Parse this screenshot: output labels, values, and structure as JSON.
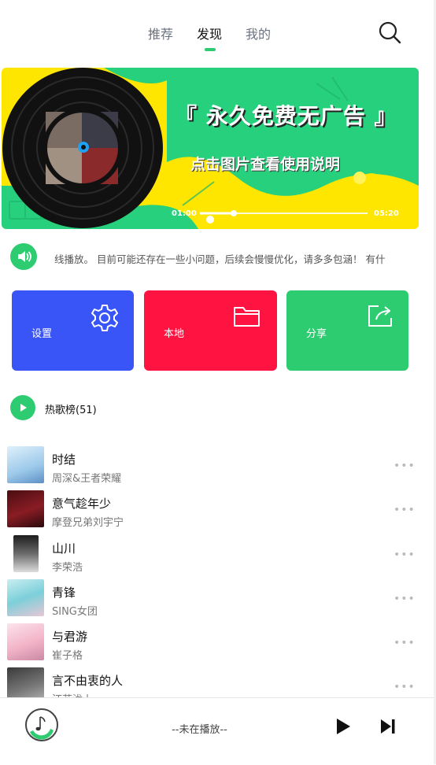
{
  "nav": {
    "tabs": [
      {
        "label": "推荐",
        "active": false
      },
      {
        "label": "发现",
        "active": true
      },
      {
        "label": "我的",
        "active": false
      }
    ],
    "search_icon": "search-icon",
    "accent": "#2ecc71"
  },
  "banner": {
    "title": "『 永久免费无广告 』",
    "subtitle": "点击图片查看使用说明",
    "time_current": "01:00",
    "time_total": "05:20",
    "progress": 0.2,
    "colors": {
      "yellow": "#ffe600",
      "green": "#26d07c"
    }
  },
  "notice": {
    "icon": "speaker-icon",
    "text": "线播放。 目前可能还存在一些小问题，后续会慢慢优化，请多多包涵！ 有什"
  },
  "cards": [
    {
      "label": "设置",
      "icon": "gear-icon",
      "color": "#3a55f7"
    },
    {
      "label": "本地",
      "icon": "folder-icon",
      "color": "#ff1441"
    },
    {
      "label": "分享",
      "icon": "share-icon",
      "color": "#2ecc71"
    }
  ],
  "hot": {
    "label": "热歌榜(51)",
    "icon": "play-icon"
  },
  "songs": [
    {
      "name": "时结",
      "artist": "周深&王者荣耀"
    },
    {
      "name": "意气趁年少",
      "artist": "摩登兄弟刘宇宁"
    },
    {
      "name": "山川",
      "artist": "李荣浩"
    },
    {
      "name": "青锋",
      "artist": "SING女团"
    },
    {
      "name": "与君游",
      "artist": "崔子格"
    },
    {
      "name": "言不由衷的人",
      "artist": "汪苏泷上"
    }
  ],
  "more_label": "•••",
  "player": {
    "status": "--未在播放--",
    "play_icon": "play-icon",
    "next_icon": "next-icon",
    "disc_icon": "music-note-icon"
  }
}
